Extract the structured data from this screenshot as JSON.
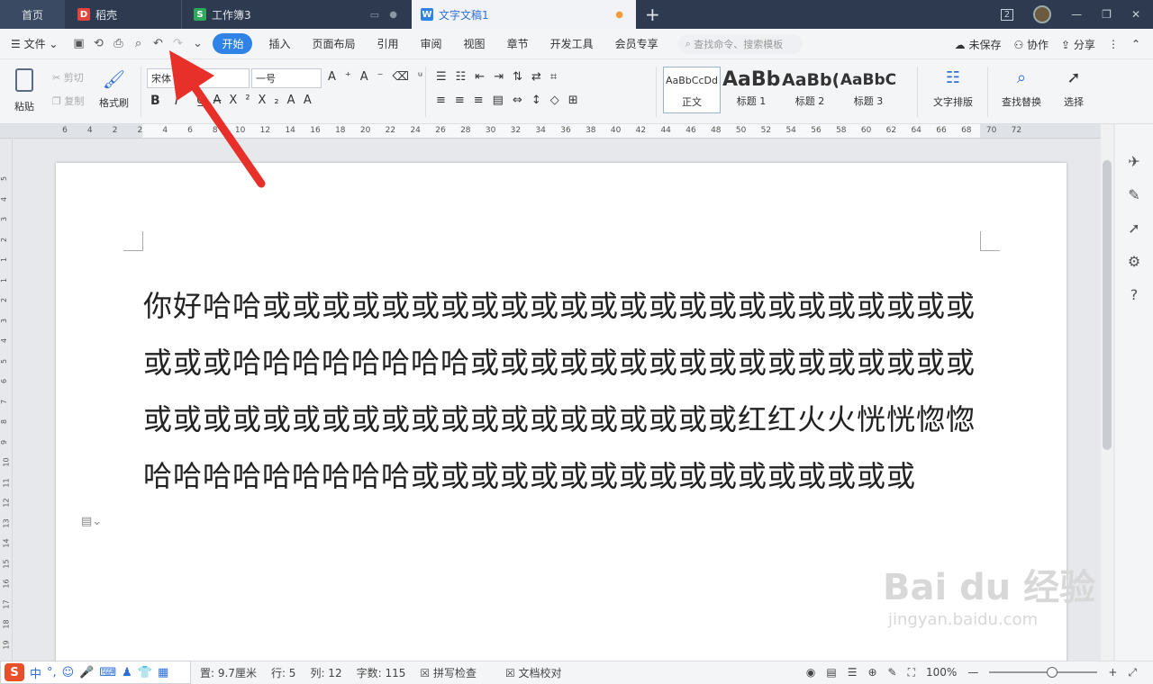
{
  "tabs": {
    "home": "首页",
    "t1": "稻壳",
    "t2": "工作簿3",
    "t3": "文字文稿1",
    "plus": "+"
  },
  "winctl": {
    "badge": "2",
    "min": "—",
    "restore": "❐",
    "close": "✕"
  },
  "menu": {
    "file": "文件",
    "items": [
      "开始",
      "插入",
      "页面布局",
      "引用",
      "审阅",
      "视图",
      "章节",
      "开发工具",
      "会员专享"
    ],
    "search_placeholder": "查找命令、搜索模板",
    "unsaved": "未保存",
    "collab": "协作",
    "share": "分享"
  },
  "ribbon": {
    "paste": "粘贴",
    "cut": "剪切",
    "copy": "复制",
    "format_painter": "格式刷",
    "font_name": "宋体",
    "font_size": "一号",
    "bold": "B",
    "italic": "I",
    "styles": [
      {
        "preview": "AaBbCcDd",
        "name": "正文"
      },
      {
        "preview": "AaBb",
        "name": "标题 1"
      },
      {
        "preview": "AaBb(",
        "name": "标题 2"
      },
      {
        "preview": "AaBbC",
        "name": "标题 3"
      }
    ],
    "text_layout": "文字排版",
    "find_replace": "查找替换",
    "select": "选择"
  },
  "ruler": {
    "ticks": [
      "6",
      "4",
      "2",
      "2",
      "4",
      "6",
      "8",
      "10",
      "12",
      "14",
      "16",
      "18",
      "20",
      "22",
      "24",
      "26",
      "28",
      "30",
      "32",
      "34",
      "36",
      "38",
      "40",
      "42",
      "44",
      "46",
      "48",
      "50",
      "52",
      "54",
      "56",
      "58",
      "60",
      "62",
      "64",
      "66",
      "68",
      "70",
      "72"
    ]
  },
  "vruler": {
    "ticks": [
      "5",
      "4",
      "3",
      "2",
      "1",
      "1",
      "2",
      "3",
      "4",
      "5",
      "6",
      "7",
      "8",
      "9",
      "10",
      "11",
      "12",
      "13",
      "14",
      "15",
      "16",
      "17",
      "18",
      "19",
      "20"
    ]
  },
  "document": {
    "text": "你好哈哈或或或或或或或或或或或或或或或或或或或或或或或或或或或哈哈哈哈哈哈哈哈或或或或或或或或或或或或或或或或或或或或或或或或或或或或或或或或或或或或或红红火火恍恍惚惚哈哈哈哈哈哈哈哈哈或或或或或或或或或或或或或或或或或"
  },
  "status": {
    "pos": "置: 9.7厘米",
    "row": "行: 5",
    "col": "列: 12",
    "words": "字数: 115",
    "spell": "拼写检查",
    "proof": "文档校对",
    "zoom": "100%"
  },
  "ime": {
    "logo": "S",
    "lang": "中"
  },
  "watermark": {
    "brand": "Bai du 经验",
    "url": "jingyan.baidu.com"
  },
  "colors": {
    "accent": "#2f82e6",
    "tabbar": "#2e3a4f",
    "arrow": "#e8302a"
  }
}
